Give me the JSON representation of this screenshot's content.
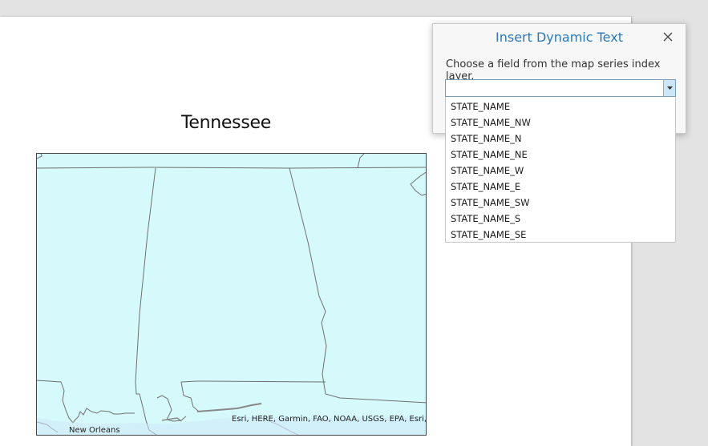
{
  "layout_page": {
    "title": "Tennessee",
    "map": {
      "attribution": "Esri, HERE, Garmin, FAO, NOAA, USGS, EPA, Esri, USGS",
      "city_label": "New Orleans",
      "water_color": "#d6f9fb"
    }
  },
  "dialog": {
    "title": "Insert Dynamic Text",
    "prompt": "Choose a field from the map series index layer.",
    "field_value": "",
    "dropdown_options": [
      "STATE_NAME",
      "STATE_NAME_NW",
      "STATE_NAME_N",
      "STATE_NAME_NE",
      "STATE_NAME_W",
      "STATE_NAME_E",
      "STATE_NAME_SW",
      "STATE_NAME_S",
      "STATE_NAME_SE"
    ],
    "accent_color": "#2a7ab8"
  }
}
